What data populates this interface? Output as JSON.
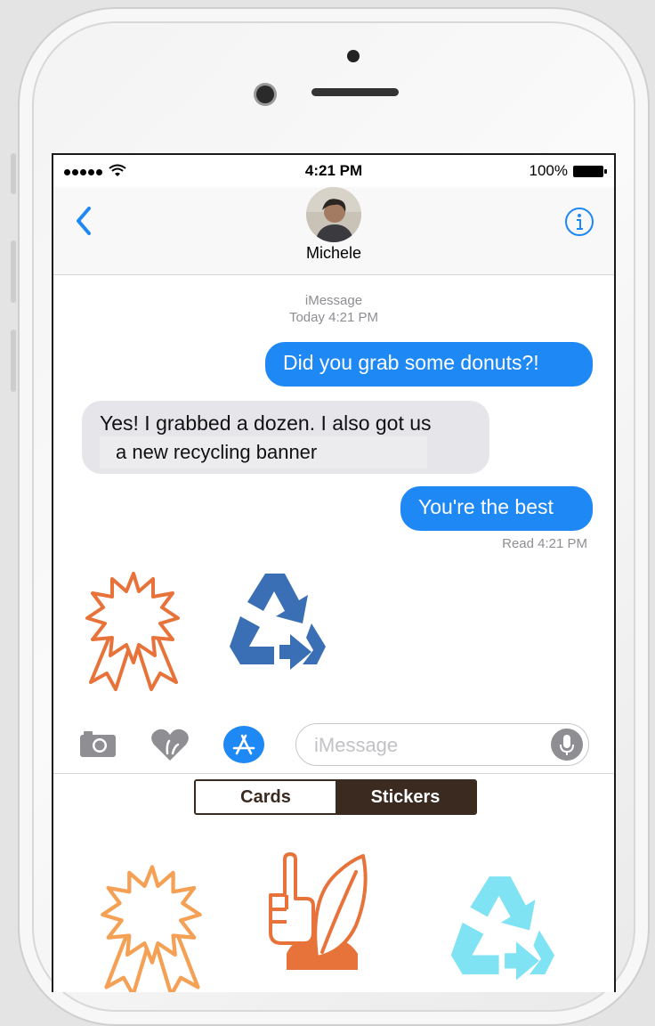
{
  "status_bar": {
    "time": "4:21 PM",
    "battery": "100%"
  },
  "header": {
    "contact_name": "Michele"
  },
  "thread": {
    "service": "iMessage",
    "timestamp": "Today 4:21 PM",
    "messages": [
      {
        "from": "me",
        "text": "Did you grab some donuts?!"
      },
      {
        "from": "them",
        "text": "Yes! I grabbed a dozen. I also got us"
      },
      {
        "from": "them_overlay",
        "text": "a new recycling banner"
      },
      {
        "from": "me",
        "text": "You're the best"
      }
    ],
    "read_receipt": "Read 4:21 PM"
  },
  "input": {
    "placeholder": "iMessage"
  },
  "tray": {
    "tabs": [
      "Cards",
      "Stickers"
    ],
    "selected": "Stickers"
  },
  "colors": {
    "imessage_blue": "#1e88f5",
    "incoming_gray": "#e5e5ea",
    "sticker_orange": "#e8733a",
    "recycle_blue": "#3a6fb5",
    "recycle_cyan": "#7fe3f3",
    "segment_brown": "#3b2a20"
  },
  "icons": [
    "back-chevron-icon",
    "info-icon",
    "camera-icon",
    "digital-touch-icon",
    "app-store-icon",
    "microphone-icon"
  ]
}
